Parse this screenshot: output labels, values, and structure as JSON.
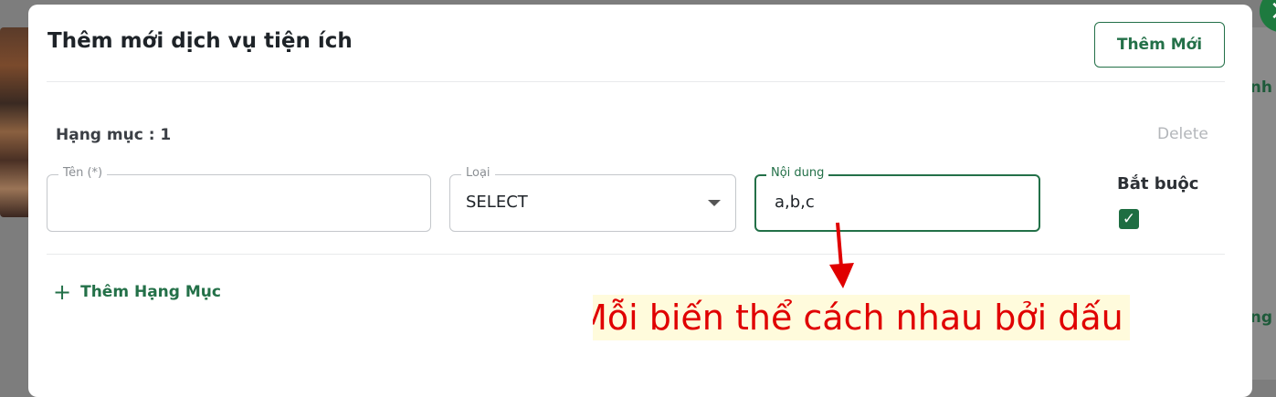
{
  "background": {
    "right_text_top": "nh",
    "right_text_bottom": "ng"
  },
  "modal": {
    "title": "Thêm mới dịch vụ tiện ích",
    "add_new_label": "Thêm Mới",
    "close_icon": "×"
  },
  "category": {
    "label": "Hạng mục : 1",
    "delete_label": "Delete",
    "fields": {
      "name": {
        "label": "Tên (*)",
        "value": ""
      },
      "type": {
        "label": "Loại",
        "value": "SELECT"
      },
      "content": {
        "label": "Nội dung",
        "value": "a,b,c"
      }
    },
    "required_label": "Bắt buộc",
    "required_checked": true,
    "checkmark": "✓"
  },
  "add_category": {
    "icon": "+",
    "label": "Thêm Hạng Mục"
  },
  "annotation": {
    "text": "Mỗi biến thể cách nhau bởi dấu ,"
  },
  "colors": {
    "accent": "#237048",
    "annotation_text": "#e00000",
    "annotation_bg": "#fffbdc"
  }
}
